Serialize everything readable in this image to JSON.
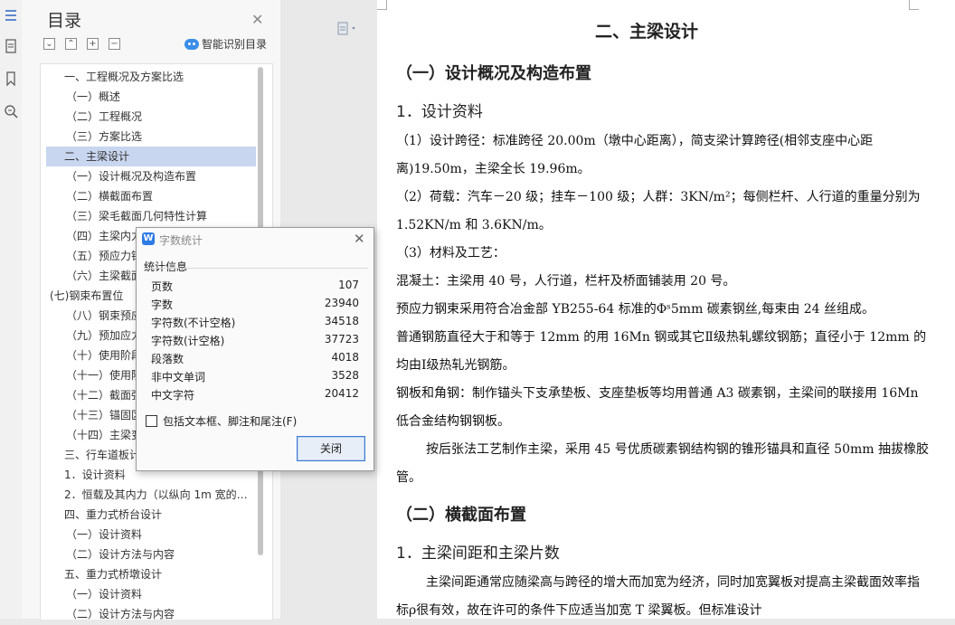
{
  "rail_icons": [
    "toc-icon",
    "document-icon",
    "bookmark-icon",
    "search-zoom-icon"
  ],
  "toc": {
    "title": "目录",
    "smart_label": "智能识别目录",
    "items": [
      {
        "label": "一、工程概况及方案比选",
        "level": 1
      },
      {
        "label": "（一）概述",
        "level": 2
      },
      {
        "label": "（二）工程概况",
        "level": 2
      },
      {
        "label": "（三）方案比选",
        "level": 2
      },
      {
        "label": "二、主梁设计",
        "level": 1,
        "selected": true
      },
      {
        "label": "（一）设计概况及构造布置",
        "level": 2
      },
      {
        "label": "（二）横截面布置",
        "level": 2
      },
      {
        "label": "（三）梁毛截面几何特性计算",
        "level": 2
      },
      {
        "label": "（四）主梁内力",
        "level": 2
      },
      {
        "label": "（五）预应力钢",
        "level": 2
      },
      {
        "label": "（六）主梁截面",
        "level": 2
      },
      {
        "label": "(七)钢束布置位",
        "level": 0
      },
      {
        "label": "（八）钢束预应",
        "level": 2
      },
      {
        "label": "（九）预加应力",
        "level": 2
      },
      {
        "label": "（十）使用阶段",
        "level": 2
      },
      {
        "label": "（十一）使用阶",
        "level": 2
      },
      {
        "label": "（十二）截面强",
        "level": 2
      },
      {
        "label": "（十三）锚固区",
        "level": 2
      },
      {
        "label": "（十四）主梁变",
        "level": 2
      },
      {
        "label": "三、行车道板计",
        "level": 1
      },
      {
        "label": "1．设计资料",
        "level": 1
      },
      {
        "label": "2．恒载及其内力（以纵向 1m 宽的…",
        "level": 1
      },
      {
        "label": "四、重力式桥台设计",
        "level": 1
      },
      {
        "label": "（一）设计资料",
        "level": 2
      },
      {
        "label": "（二）设计方法与内容",
        "level": 2
      },
      {
        "label": "五、重力式桥墩设计",
        "level": 1
      },
      {
        "label": "（一）设计资料",
        "level": 2
      },
      {
        "label": "（二）设计方法与内容",
        "level": 2
      }
    ]
  },
  "doc": {
    "h1": "二、主梁设计",
    "sec1": "（一）设计概况及构造布置",
    "sub1": "1．设计资料",
    "paras": [
      "（1）设计跨径：标准跨径 20.00m（墩中心距离），简支梁计算跨径(相邻支座中心距离)19.50m，主梁全长 19.96m。",
      "（2）荷载：汽车－20 级；挂车－100 级；人群：3KN/m²；每侧栏杆、人行道的重量分别为 1.52KN/m 和 3.6KN/m。",
      "（3）材料及工艺：",
      "混凝土：主梁用 40 号，人行道，栏杆及桥面铺装用 20 号。",
      "预应力钢束采用符合冶金部 YB255-64 标准的Φˢ5mm 碳素钢丝,每束由 24 丝组成。",
      "普通钢筋直径大于和等于 12mm 的用 16Mn 钢或其它Ⅱ级热轧螺纹钢筋；直径小于 12mm 的均由Ⅰ级热轧光钢筋。",
      "钢板和角钢：制作锚头下支承垫板、支座垫板等均用普通 A3 碳素钢，主梁间的联接用 16Mn 低合金结构钢钢板。",
      "按后张法工艺制作主梁，采用 45 号优质碳素钢结构钢的锥形锚具和直径 50mm 抽拔橡胶管。"
    ],
    "sec2": "（二）横截面布置",
    "sub2": "1．主梁间距和主梁片数",
    "para_last": "主梁间距通常应随梁高与跨径的增大而加宽为经济，同时加宽翼板对提高主梁截面效率指标ρ很有效，故在许可的条件下应适当加宽 T 梁翼板。但标准设计"
  },
  "dialog": {
    "title": "字数统计",
    "group": "统计信息",
    "stats": [
      {
        "k": "页数",
        "v": "107"
      },
      {
        "k": "字数",
        "v": "23940"
      },
      {
        "k": "字符数(不计空格)",
        "v": "34518"
      },
      {
        "k": "字符数(计空格)",
        "v": "37723"
      },
      {
        "k": "段落数",
        "v": "4018"
      },
      {
        "k": "非中文单词",
        "v": "3528"
      },
      {
        "k": "中文字符",
        "v": "20412"
      }
    ],
    "checkbox_label": "包括文本框、脚注和尾注(F)",
    "close_label": "关闭"
  }
}
